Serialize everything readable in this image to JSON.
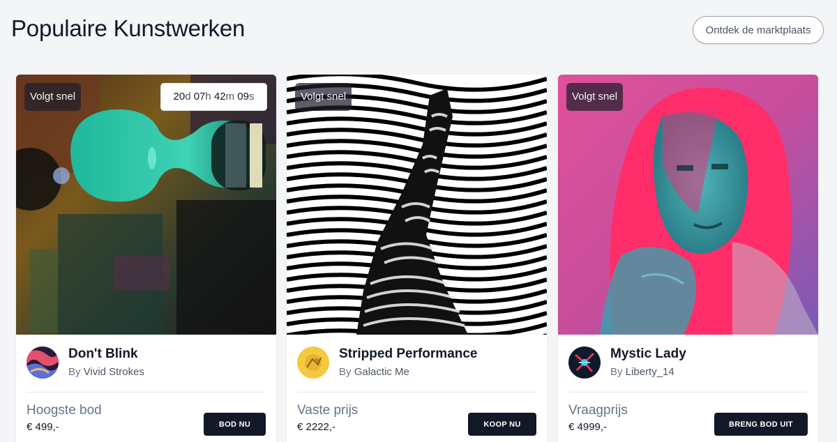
{
  "header": {
    "title": "Populaire Kunstwerken",
    "marketplace_button": "Ontdek de marktplaats"
  },
  "cards": [
    {
      "tag": "Volgt snel",
      "timer": {
        "d": "20",
        "d_unit": "d",
        "h": "07",
        "h_unit": "h",
        "m": "42",
        "m_unit": "m",
        "s": "09",
        "s_unit": "s"
      },
      "title": "Don't Blink",
      "by": "By",
      "artist": "Vivid Strokes",
      "price_label": "Hoogste bod",
      "price": "€ 499,-",
      "action": "BOD NU"
    },
    {
      "tag": "Volgt snel",
      "title": "Stripped Performance",
      "by": "By",
      "artist": "Galactic Me",
      "price_label": "Vaste prijs",
      "price": "€ 2222,-",
      "action": "KOOP NU"
    },
    {
      "tag": "Volgt snel",
      "title": "Mystic Lady",
      "by": "By",
      "artist": "Liberty_14",
      "price_label": "Vraagprijs",
      "price": "€ 4999,-",
      "action": "BRENG BOD UIT"
    }
  ]
}
